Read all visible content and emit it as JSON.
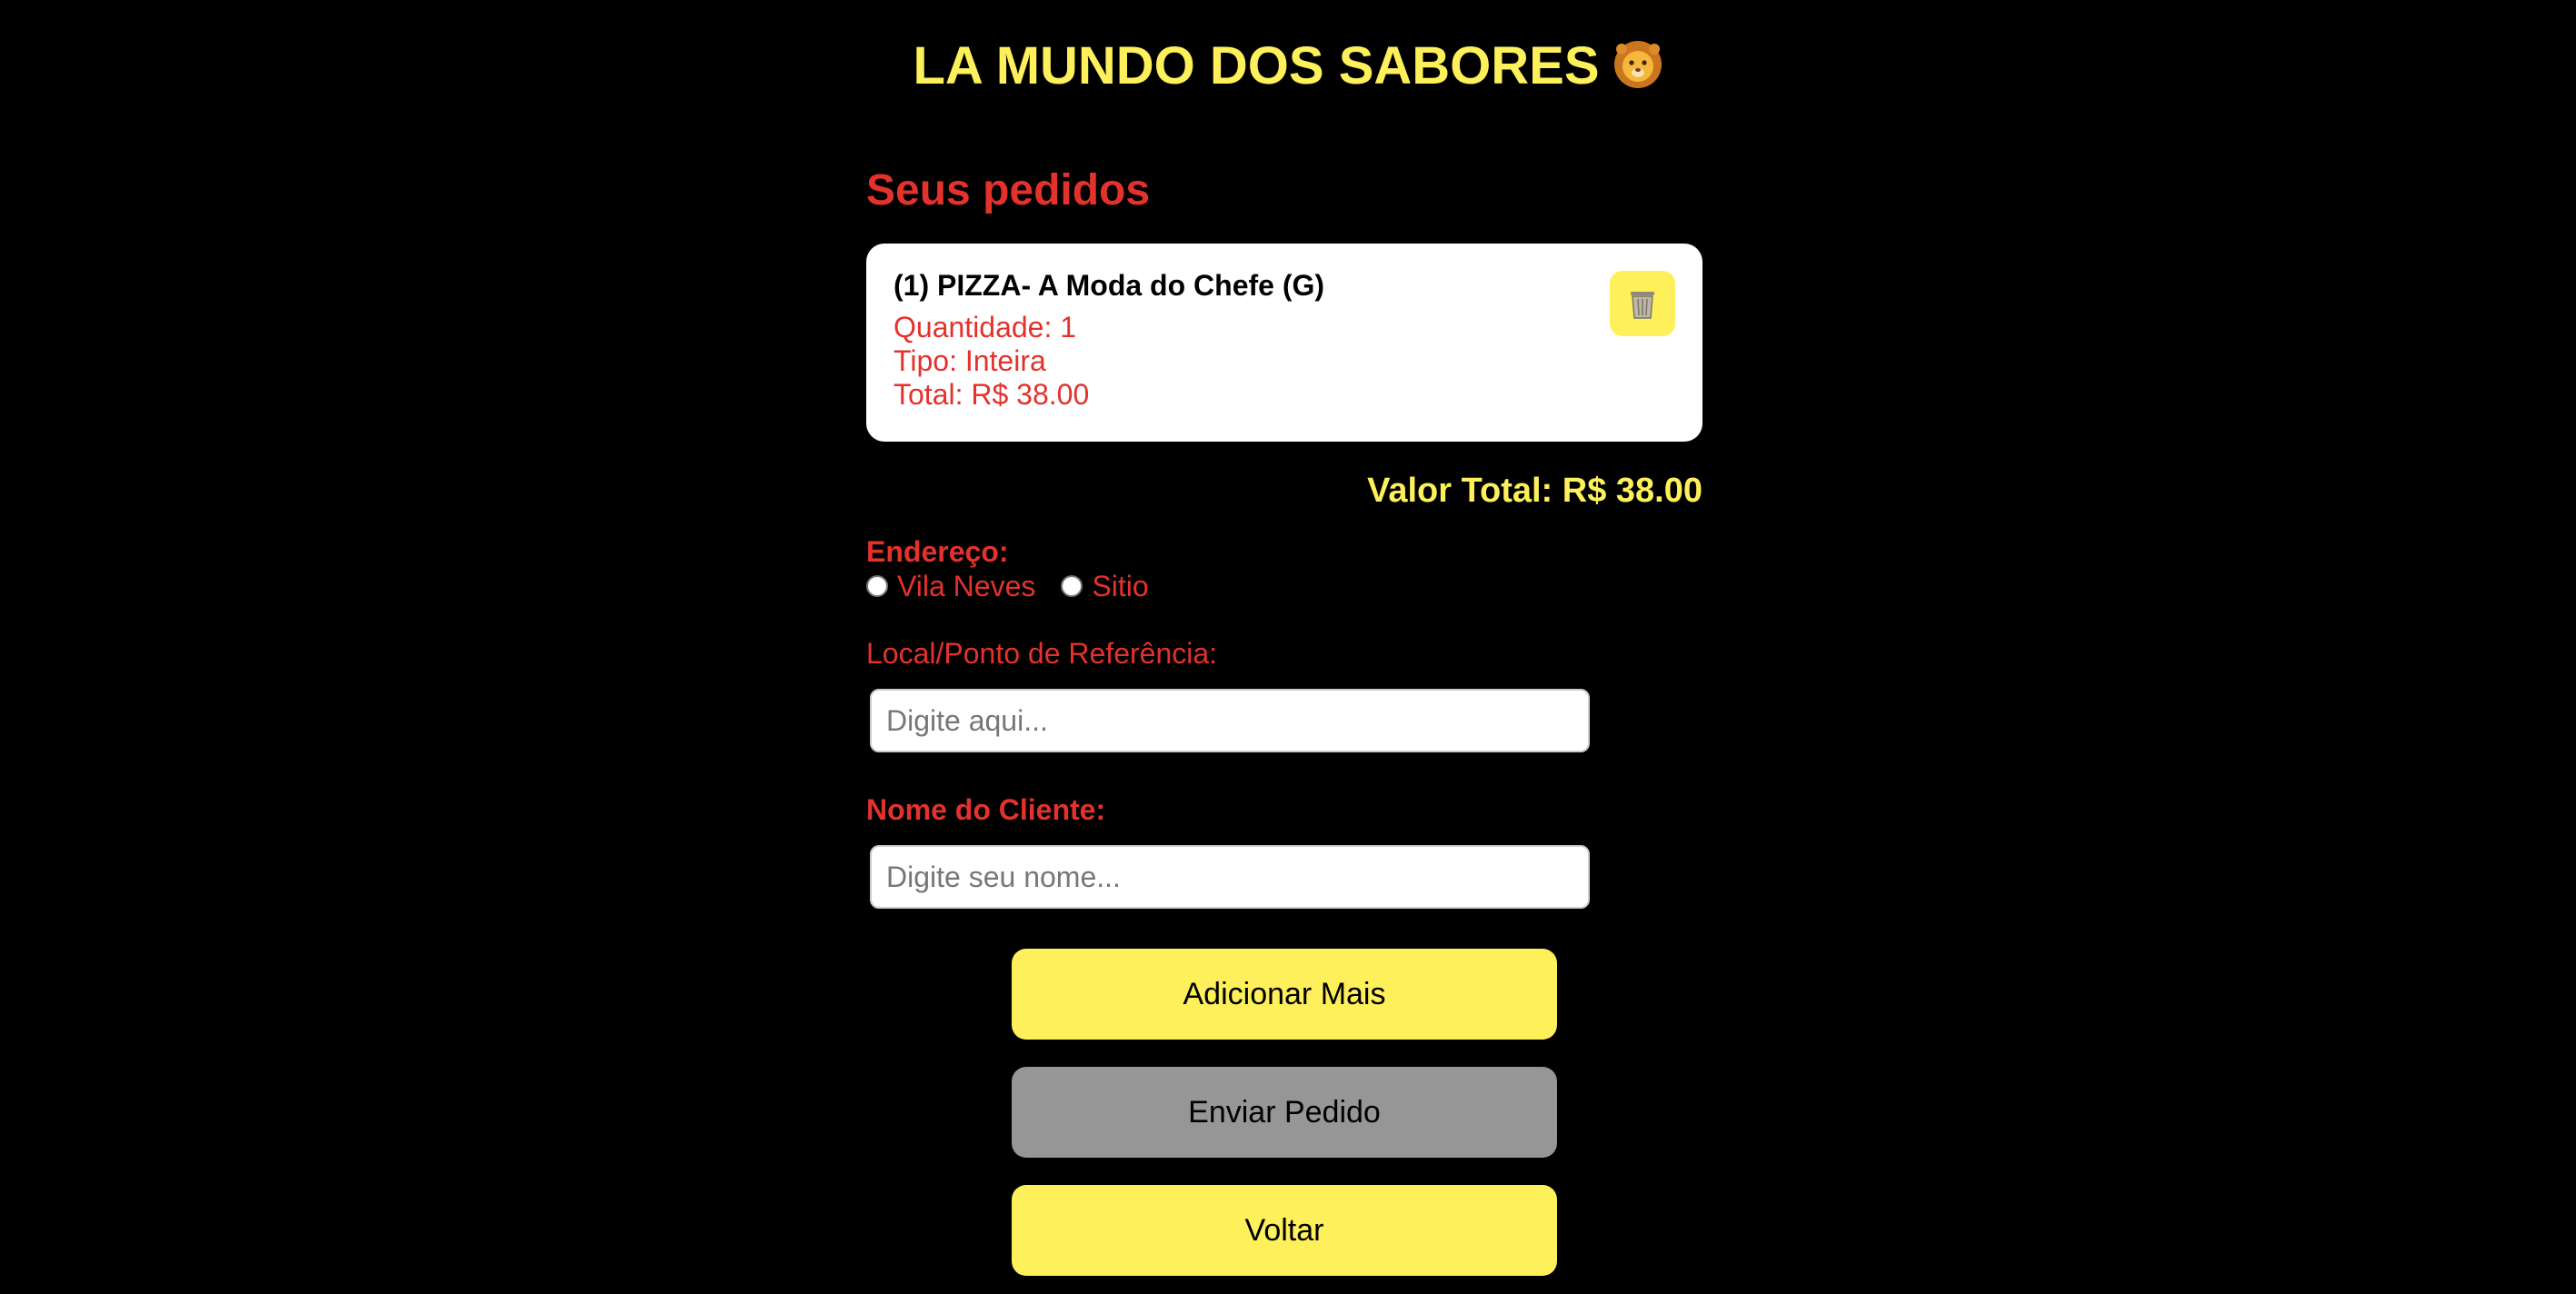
{
  "header": {
    "title": "LA MUNDO DOS SABORES",
    "title_icon": "lion-face-icon"
  },
  "orders": {
    "heading": "Seus pedidos",
    "items": [
      {
        "name": "(1) PIZZA- A Moda do Chefe (G)",
        "quantity": "Quantidade: 1",
        "type": "Tipo: Inteira",
        "total": "Total: R$ 38.00",
        "delete_icon": "trash-can-icon"
      }
    ]
  },
  "summary": {
    "total": "Valor Total: R$ 38.00"
  },
  "address": {
    "label": "Endereço:",
    "options": [
      "Vila Neves",
      "Sitio"
    ]
  },
  "reference": {
    "label": "Local/Ponto de Referência:",
    "value": "",
    "placeholder": "Digite aqui..."
  },
  "customer": {
    "label": "Nome do Cliente:",
    "value": "",
    "placeholder": "Digite seu nome..."
  },
  "actions": {
    "add_more": "Adicionar Mais",
    "send_order": "Enviar Pedido",
    "back": "Voltar"
  },
  "colors": {
    "background": "#000000",
    "accent_yellow": "#fdf05a",
    "accent_red": "#e3322c",
    "disabled_gray": "#969696"
  }
}
